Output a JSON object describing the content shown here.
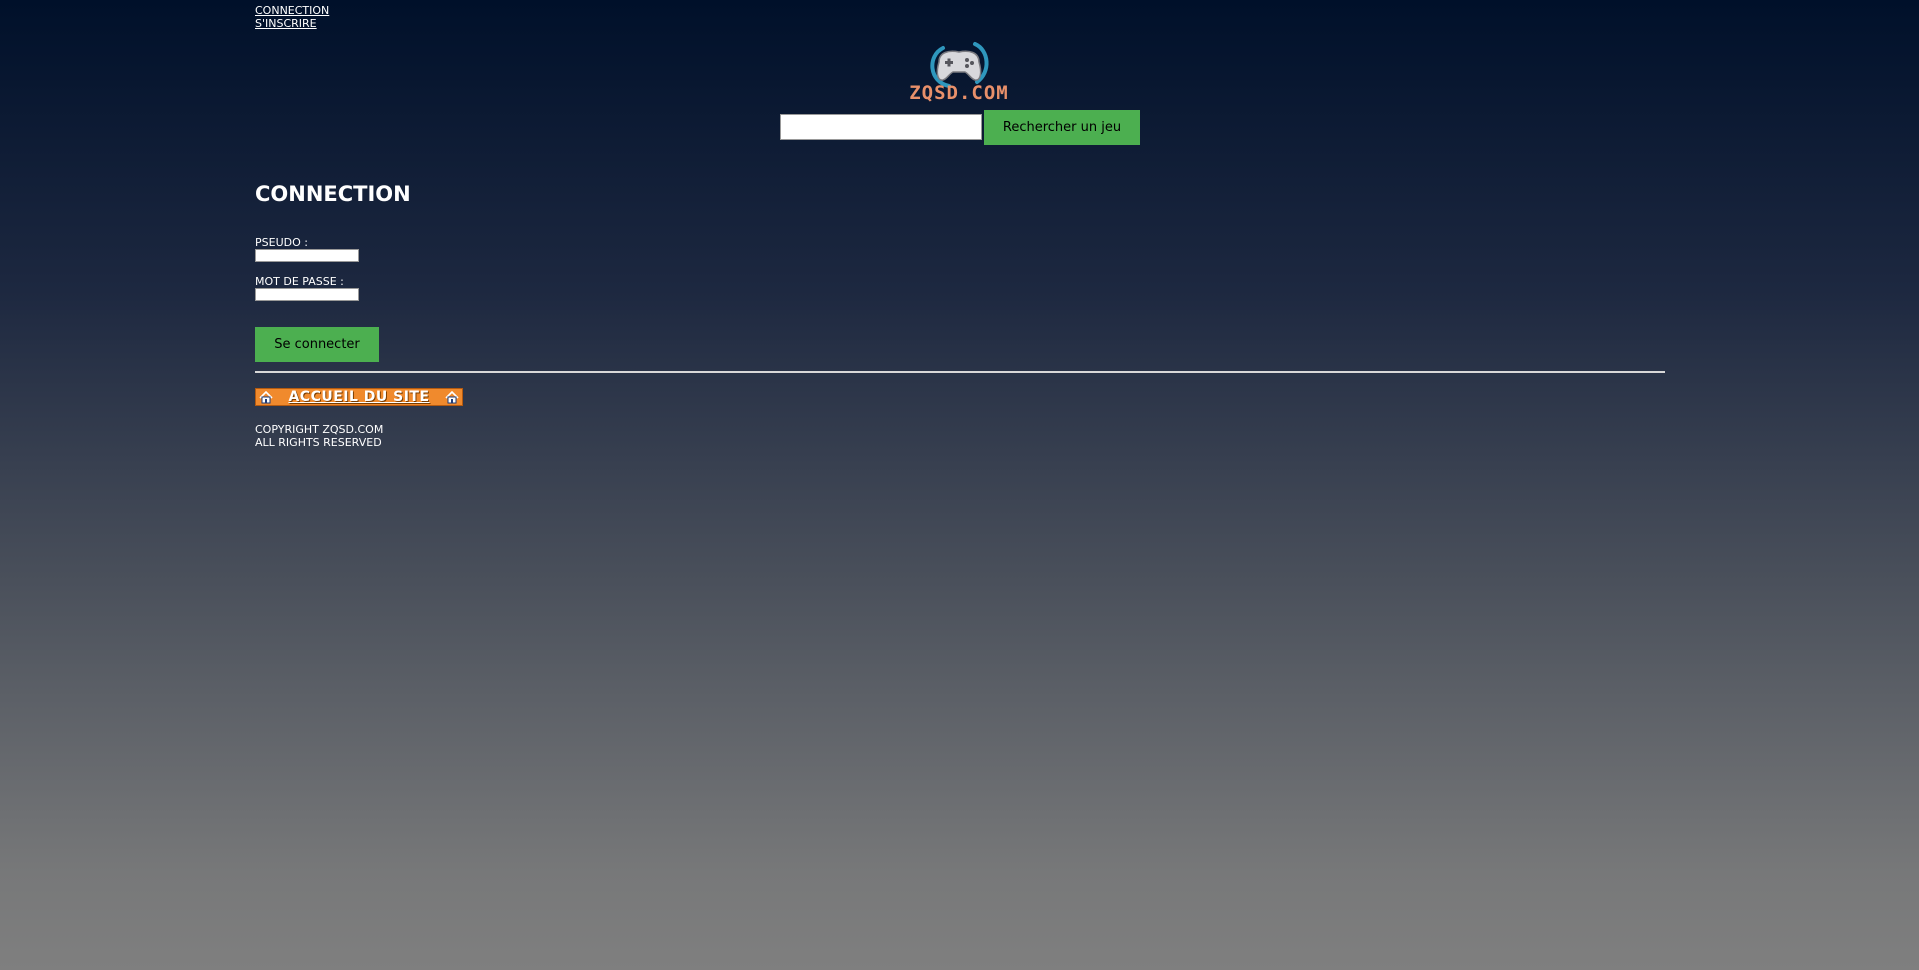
{
  "header": {
    "links": {
      "login": "CONNECTION",
      "register": "S'INSCRIRE"
    },
    "logo_text": "ZQSD.COM",
    "logo_icon": "gamepad-icon",
    "search": {
      "value": "",
      "button_label": "Rechercher un jeu"
    }
  },
  "main": {
    "title": "CONNECTION",
    "fields": {
      "username_label": "PSEUDO :",
      "username_value": "",
      "password_label": "MOT DE PASSE :",
      "password_value": ""
    },
    "submit_label": "Se connecter"
  },
  "footer": {
    "home_link_label": "ACCUEIL DU SITE",
    "home_link_icon": "house-icon",
    "copyright_line1": "COPYRIGHT ZQSD.COM",
    "copyright_line2": "ALL RIGHTS RESERVED"
  },
  "colors": {
    "button_green": "#4caf50",
    "banner_orange": "#f08a2d",
    "logo_text": "#e8906a",
    "logo_ring": "#3aa6c8"
  }
}
